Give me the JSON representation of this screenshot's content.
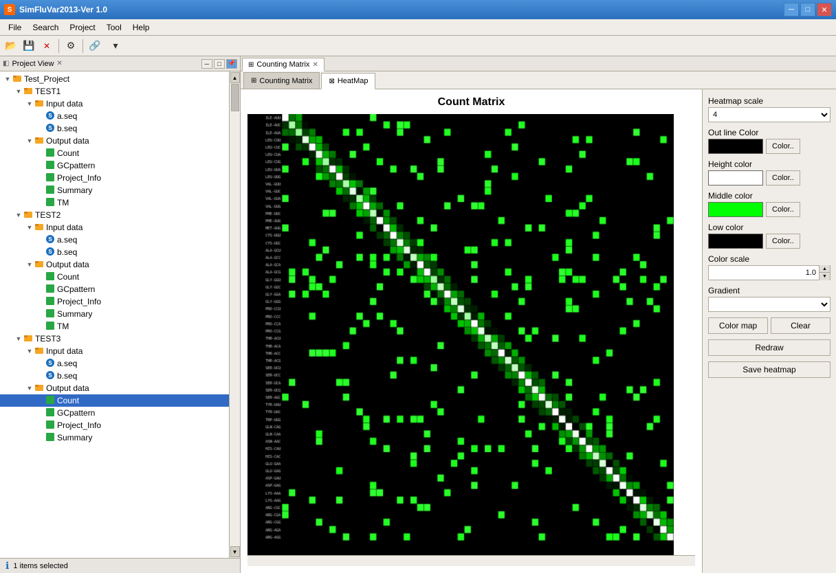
{
  "app": {
    "title": "SimFluVar2013-Ver 1.0",
    "icon_label": "S"
  },
  "title_buttons": {
    "minimize": "─",
    "maximize": "□",
    "close": "✕"
  },
  "menu": {
    "items": [
      "File",
      "Search",
      "Project",
      "Tool",
      "Help"
    ]
  },
  "toolbar": {
    "buttons": [
      "📂",
      "💾",
      "✕",
      "🔧",
      "🔗"
    ]
  },
  "left_panel": {
    "title": "Project View",
    "tree": [
      {
        "label": "Test_Project",
        "level": 0,
        "type": "project",
        "expanded": true,
        "toggle": "▼"
      },
      {
        "label": "TEST1",
        "level": 1,
        "type": "folder",
        "expanded": true,
        "toggle": "▼"
      },
      {
        "label": "Input data",
        "level": 2,
        "type": "folder-open",
        "expanded": true,
        "toggle": "▼"
      },
      {
        "label": "a.seq",
        "level": 3,
        "type": "seq",
        "toggle": ""
      },
      {
        "label": "b.seq",
        "level": 3,
        "type": "seq",
        "toggle": ""
      },
      {
        "label": "Output data",
        "level": 2,
        "type": "folder-open",
        "expanded": true,
        "toggle": "▼"
      },
      {
        "label": "Count",
        "level": 3,
        "type": "file-green",
        "toggle": ""
      },
      {
        "label": "GCpattern",
        "level": 3,
        "type": "file-green",
        "toggle": ""
      },
      {
        "label": "Project_Info",
        "level": 3,
        "type": "file-green",
        "toggle": ""
      },
      {
        "label": "Summary",
        "level": 3,
        "type": "file-green",
        "toggle": ""
      },
      {
        "label": "TM",
        "level": 3,
        "type": "file-green",
        "toggle": ""
      },
      {
        "label": "TEST2",
        "level": 1,
        "type": "folder",
        "expanded": true,
        "toggle": "▼"
      },
      {
        "label": "Input data",
        "level": 2,
        "type": "folder-open",
        "expanded": true,
        "toggle": "▼"
      },
      {
        "label": "a.seq",
        "level": 3,
        "type": "seq",
        "toggle": ""
      },
      {
        "label": "b.seq",
        "level": 3,
        "type": "seq",
        "toggle": ""
      },
      {
        "label": "Output data",
        "level": 2,
        "type": "folder-open",
        "expanded": true,
        "toggle": "▼"
      },
      {
        "label": "Count",
        "level": 3,
        "type": "file-green",
        "toggle": ""
      },
      {
        "label": "GCpattern",
        "level": 3,
        "type": "file-green",
        "toggle": ""
      },
      {
        "label": "Project_Info",
        "level": 3,
        "type": "file-green",
        "toggle": ""
      },
      {
        "label": "Summary",
        "level": 3,
        "type": "file-green",
        "toggle": ""
      },
      {
        "label": "TM",
        "level": 3,
        "type": "file-green",
        "toggle": ""
      },
      {
        "label": "TEST3",
        "level": 1,
        "type": "folder",
        "expanded": true,
        "toggle": "▼"
      },
      {
        "label": "Input data",
        "level": 2,
        "type": "folder-open",
        "expanded": true,
        "toggle": "▼"
      },
      {
        "label": "a.seq",
        "level": 3,
        "type": "seq",
        "toggle": ""
      },
      {
        "label": "b.seq",
        "level": 3,
        "type": "seq",
        "toggle": ""
      },
      {
        "label": "Output data",
        "level": 2,
        "type": "folder-open",
        "expanded": true,
        "toggle": "▼"
      },
      {
        "label": "Count",
        "level": 3,
        "type": "file-green",
        "toggle": "",
        "selected": true
      },
      {
        "label": "GCpattern",
        "level": 3,
        "type": "file-green",
        "toggle": ""
      },
      {
        "label": "Project_Info",
        "level": 3,
        "type": "file-green",
        "toggle": ""
      },
      {
        "label": "Summary",
        "level": 3,
        "type": "file-green",
        "toggle": ""
      }
    ]
  },
  "tabs": {
    "counting_matrix_tab": "Counting Matrix",
    "inner_tab_counting": "Counting Matrix",
    "inner_tab_heatmap": "HeatMap"
  },
  "heatmap": {
    "title": "Count Matrix",
    "scale_label": "Heatmap scale",
    "scale_value": "4",
    "outline_color_label": "Out line Color",
    "outline_color": "#000000",
    "height_color_label": "Height color",
    "height_color": "#ffffff",
    "middle_color_label": "Middle color",
    "middle_color": "#00ff00",
    "low_color_label": "Low color",
    "low_color": "#000000",
    "color_scale_label": "Color scale",
    "color_scale_value": "1.0",
    "gradient_label": "Gradient",
    "color_btn": "Color..",
    "color_map_btn": "Color map",
    "clear_btn": "Clear",
    "redraw_btn": "Redraw",
    "save_btn": "Save heatmap"
  },
  "status_bar": {
    "text": "1 items selected",
    "icon": "ℹ"
  },
  "y_labels": [
    "ILE-AUU",
    "ILE-AUC",
    "ILE-AUA",
    "LEU-CUU",
    "LEU-CUC",
    "LEU-CUA",
    "LEU-CUG",
    "LEU-UUA",
    "LEU-UUG",
    "VAL-GUU",
    "VAL-GUC",
    "VAL-GUA",
    "VAL-GUG",
    "PHE-UUC",
    "PHE-AUG",
    "MET-AUG",
    "CYS-UGU",
    "CYS-UGC",
    "ALA-GCU",
    "ALA-GCC",
    "ALA-GCA",
    "ALA-GCG",
    "GLY-GGU",
    "GLY-GGC",
    "GLY-GGA",
    "GLY-GGG",
    "PRO-CCU",
    "PRO-CCC",
    "PRO-CCA",
    "PRO-CCG",
    "THR-ACU",
    "THR-ACA",
    "THR-ACC",
    "THR-ACG",
    "SER-UCU",
    "SER-UCC",
    "SER-UCA",
    "SER-UCG",
    "SER-AGC",
    "TYR-UAU",
    "TYR-UAC",
    "TRP-UGG",
    "GLN-CAG",
    "GLN-CAA",
    "ASN-AAC",
    "HIS-CAU",
    "HIS-CAC",
    "GLU-GAA",
    "GLU-GAG",
    "ASP-GAU",
    "ASP-GAG",
    "LYS-AAA",
    "LYS-AAG",
    "ARG-CGC",
    "ARG-CGA",
    "ARG-CGG",
    "ARG-AGA",
    "ARG-AGG"
  ]
}
